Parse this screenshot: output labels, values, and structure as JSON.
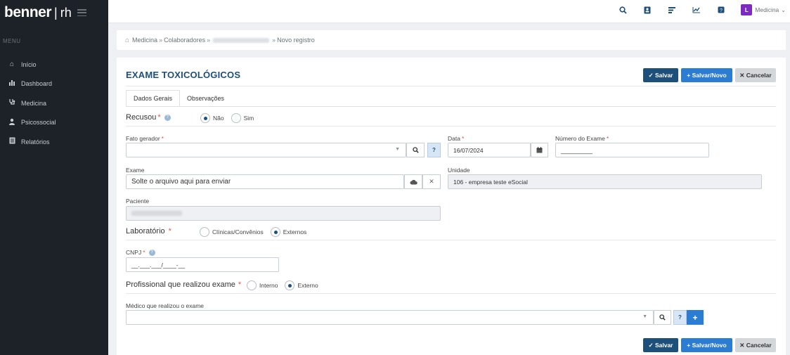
{
  "brand": {
    "name": "benner",
    "separator": "|",
    "module": "rh"
  },
  "sidebar": {
    "menu_title": "MENU",
    "items": [
      {
        "label": "Início",
        "icon": "home-icon"
      },
      {
        "label": "Dashboard",
        "icon": "bar-chart-icon"
      },
      {
        "label": "Medicina",
        "icon": "stethoscope-icon"
      },
      {
        "label": "Psicossocial",
        "icon": "person-icon"
      },
      {
        "label": "Relatórios",
        "icon": "report-icon"
      }
    ]
  },
  "topbar": {
    "icons": [
      "search-icon",
      "contacts-icon",
      "list-icon",
      "chart-icon",
      "help-icon"
    ],
    "user": {
      "initial": "L",
      "name": "Medicina"
    }
  },
  "breadcrumb": {
    "items": [
      "Medicina",
      "Colaboradores",
      "Novo registro"
    ],
    "separator": "»"
  },
  "page": {
    "title": "EXAME TOXICOLÓGICOS",
    "buttons": {
      "save": "✓ Salvar",
      "save_new": "+ Salvar/Novo",
      "cancel": "✕ Cancelar"
    },
    "tabs": [
      "Dados Gerais",
      "Observações"
    ],
    "active_tab": "Dados Gerais"
  },
  "form": {
    "recusou": {
      "label": "Recusou",
      "required": "*",
      "help": "?",
      "options": [
        "Não",
        "Sim"
      ],
      "selected": "Não"
    },
    "fato_gerador": {
      "label": "Fato gerador",
      "required": "*",
      "value": ""
    },
    "data": {
      "label": "Data",
      "required": "*",
      "value": "16/07/2024"
    },
    "numero_exame": {
      "label": "Número do Exame",
      "required": "*",
      "value": "_________"
    },
    "exame": {
      "label": "Exame",
      "value": "Solte o arquivo aqui para enviar"
    },
    "unidade": {
      "label": "Unidade",
      "value": "106 - empresa teste eSocial"
    },
    "paciente": {
      "label": "Paciente"
    },
    "laboratorio": {
      "label": "Laboratório",
      "required": "*",
      "options": [
        "Clínicas/Convênios",
        "Externos"
      ],
      "selected": "Externos"
    },
    "cnpj": {
      "label": "CNPJ",
      "required": "*",
      "help": "?",
      "value": "__.___.___/____-__"
    },
    "profissional": {
      "label": "Profissional que realizou exame",
      "required": "*",
      "options": [
        "Interno",
        "Externo"
      ],
      "selected": "Externo"
    },
    "medico": {
      "label": "Médico que realizou o exame",
      "value": ""
    },
    "lookup_help": "?",
    "lookup_add": "+"
  },
  "colors": {
    "primary": "#1d4f7b",
    "accent": "#2b7cd3",
    "sidebar": "#1d2128",
    "avatar": "#7b2cbf",
    "required": "#d9534f"
  }
}
